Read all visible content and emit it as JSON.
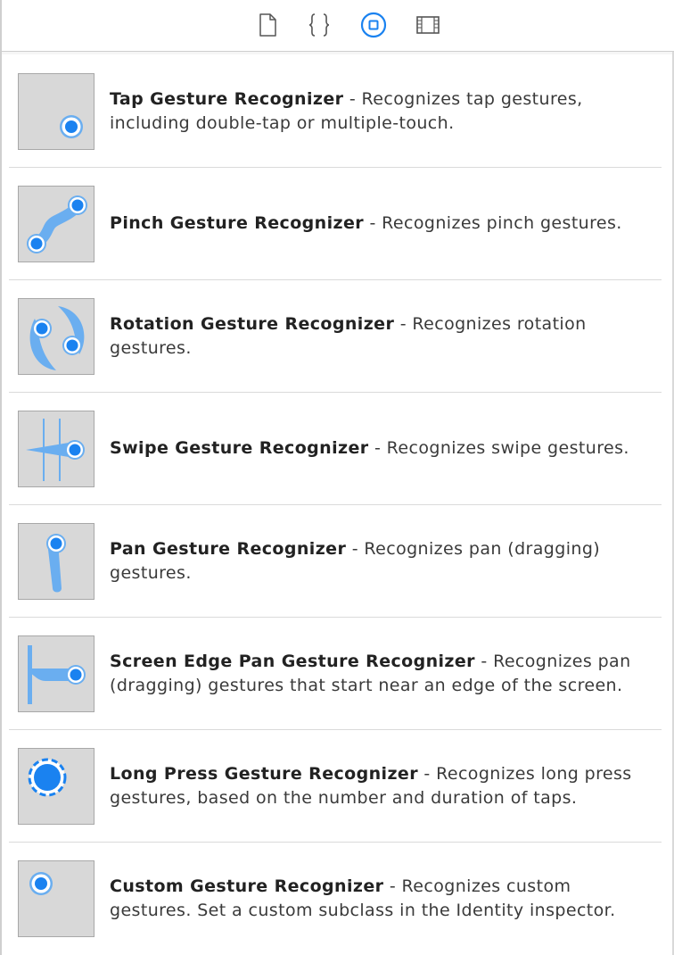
{
  "toolbar": {
    "tabs": [
      {
        "icon": "file-icon",
        "selected": false
      },
      {
        "icon": "curly-braces-icon",
        "selected": false
      },
      {
        "icon": "object-library-icon",
        "selected": true
      },
      {
        "icon": "media-library-icon",
        "selected": false
      }
    ]
  },
  "colors": {
    "accent": "#1a82f0",
    "accent_light": "#6aaef0",
    "thumb_bg": "#d8d8d8"
  },
  "items": [
    {
      "icon": "tap-gesture-icon",
      "title": "Tap Gesture Recognizer",
      "description": " - Recognizes tap gestures, including double-tap or multiple-touch."
    },
    {
      "icon": "pinch-gesture-icon",
      "title": "Pinch Gesture Recognizer",
      "description": " - Recognizes pinch gestures."
    },
    {
      "icon": "rotation-gesture-icon",
      "title": "Rotation Gesture Recognizer",
      "description": " - Recognizes rotation gestures."
    },
    {
      "icon": "swipe-gesture-icon",
      "title": "Swipe Gesture Recognizer",
      "description": " - Recognizes swipe gestures."
    },
    {
      "icon": "pan-gesture-icon",
      "title": "Pan Gesture Recognizer",
      "description": " - Recognizes pan (dragging) gestures."
    },
    {
      "icon": "screen-edge-pan-gesture-icon",
      "title": "Screen Edge Pan Gesture Recognizer",
      "description": " - Recognizes pan (dragging) gestures that start near an edge of the screen."
    },
    {
      "icon": "long-press-gesture-icon",
      "title": "Long Press Gesture Recognizer",
      "description": " - Recognizes long press gestures, based on the number and duration of taps."
    },
    {
      "icon": "custom-gesture-icon",
      "title": "Custom Gesture Recognizer",
      "description": " - Recognizes custom gestures. Set a custom subclass in the Identity inspector."
    }
  ]
}
